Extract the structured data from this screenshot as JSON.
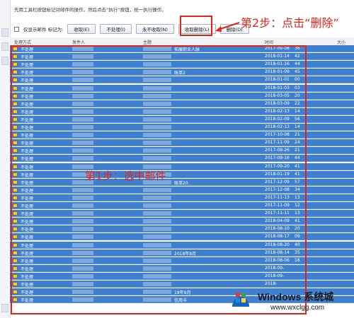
{
  "instruction": "先用工具栏按钮标记对邮件的操作，然后点击“执行”按钮，统一执行操作。",
  "toolbar": {
    "checkbox_label": "仅显示邮件 标记为:",
    "buttons": [
      "收取(E)",
      "不处理(I)",
      "永不收取(N)",
      "收取删除(L)",
      "删除(D)"
    ]
  },
  "annotations": {
    "step1": "第1步：选中邮件",
    "step2": "第2步：点击“删除”"
  },
  "columns": {
    "action": "处理方式",
    "sender": "发件人",
    "subject": "主题",
    "time": "时间",
    "size": "大小"
  },
  "rows": [
    {
      "status": "不处理",
      "subject": "拓展职业人脉",
      "time": "2017-09-08",
      "size": "36"
    },
    {
      "status": "不处理",
      "subject": "",
      "time": "2018-01-14",
      "size": "42"
    },
    {
      "status": "不处理",
      "subject": "",
      "time": "2018-01-16",
      "size": "44"
    },
    {
      "status": "不处理",
      "subject": "账单2",
      "time": "2018-01-09",
      "size": "45"
    },
    {
      "status": "不处理",
      "subject": "",
      "time": "2018-01-01",
      "size": "00"
    },
    {
      "status": "不处理",
      "subject": "",
      "time": "2018-01-03",
      "size": "03"
    },
    {
      "status": "不处理",
      "subject": "",
      "time": "2018-03-05",
      "size": "20"
    },
    {
      "status": "不处理",
      "subject": "",
      "time": "2018-03-09",
      "size": "22"
    },
    {
      "status": "不处理",
      "subject": "",
      "time": "2018-02-13",
      "size": "14"
    },
    {
      "status": "不处理",
      "subject": "",
      "time": "2018-02-09",
      "size": "56"
    },
    {
      "status": "不处理",
      "subject": "",
      "time": "2018-02-13",
      "size": "14"
    },
    {
      "status": "不处理",
      "subject": "",
      "time": "2017-10-08",
      "size": "21"
    },
    {
      "status": "不处理",
      "subject": "",
      "time": "2017-11-09",
      "size": "24"
    },
    {
      "status": "不处理",
      "subject": "",
      "time": "2017-09-26",
      "size": "21"
    },
    {
      "status": "不处理",
      "subject": "",
      "time": "2017-09-16",
      "size": "44"
    },
    {
      "status": "不处理",
      "subject": "",
      "time": "2017-09-20",
      "size": "41"
    },
    {
      "status": "不处理",
      "subject": "",
      "time": "2018-01-19",
      "size": "41"
    },
    {
      "status": "不处理",
      "subject": "账单20",
      "time": "2017-12-09",
      "size": "57"
    },
    {
      "status": "不处理",
      "subject": "",
      "time": "2017-12-08",
      "size": "34"
    },
    {
      "status": "不处理",
      "subject": "",
      "time": "2017-11-13",
      "size": "13"
    },
    {
      "status": "不处理",
      "subject": "",
      "time": "2017-11-09",
      "size": "12"
    },
    {
      "status": "不处理",
      "subject": "",
      "time": "2017-11-11",
      "size": "13"
    },
    {
      "status": "不处理",
      "subject": "",
      "time": "2018-04-09",
      "size": "41"
    },
    {
      "status": "不处理",
      "subject": "",
      "time": "2018-08-10",
      "size": "20"
    },
    {
      "status": "不处理",
      "subject": "",
      "time": "2018-08-17",
      "size": "09"
    },
    {
      "status": "不处理",
      "subject": "",
      "time": "2018-08-20",
      "size": "40"
    },
    {
      "status": "不处理",
      "subject": "2018年8月",
      "time": "2018-08-14",
      "size": "35"
    },
    {
      "status": "不处理",
      "subject": "",
      "time": "2018-08-06",
      "size": "16"
    },
    {
      "status": "不处理",
      "subject": "",
      "time": "2018-09-",
      "size": ""
    },
    {
      "status": "不处理",
      "subject": "",
      "time": "2018-09-",
      "size": ""
    },
    {
      "status": "不处理",
      "subject": "",
      "time": "2018-",
      "size": ""
    },
    {
      "status": "不处理",
      "subject": "18年9月",
      "time": "",
      "size": ""
    },
    {
      "status": "不处理",
      "subject": "信用卡",
      "time": "",
      "size": ""
    }
  ],
  "watermark": {
    "title": "Windows 系统城",
    "url": "www.wxclgg.com"
  },
  "colors": {
    "selected_row": "#3f7fcf",
    "annotation_red": "#e2231a"
  }
}
